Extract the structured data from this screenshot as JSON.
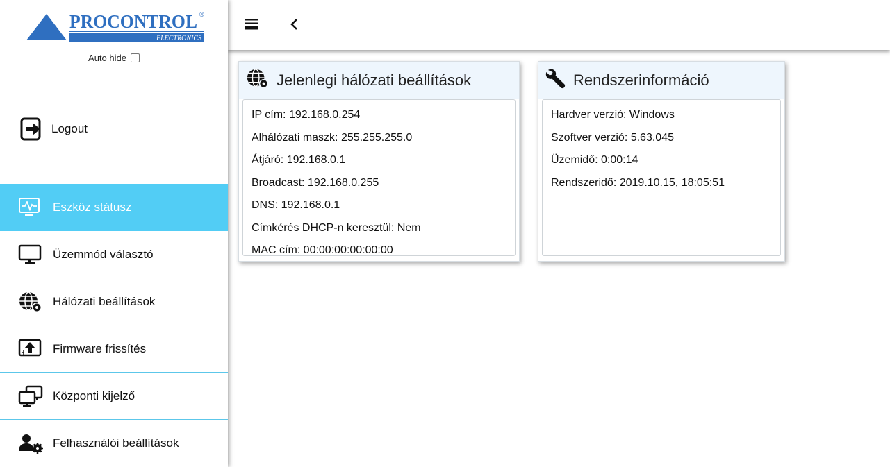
{
  "brand": {
    "name": "PROCONTROL",
    "sub": "ELECTRONICS",
    "registered": "®",
    "color": "#2f6fc0"
  },
  "sidebar": {
    "autohide_label": "Auto hide",
    "logout_label": "Logout",
    "items": [
      {
        "label": "Eszköz státusz",
        "icon": "monitor-pulse-icon",
        "active": true
      },
      {
        "label": "Üzemmód választó",
        "icon": "monitor-icon",
        "active": false
      },
      {
        "label": "Hálózati beállítások",
        "icon": "globe-gear-icon",
        "active": false
      },
      {
        "label": "Firmware frissítés",
        "icon": "upload-icon",
        "active": false
      },
      {
        "label": "Központi kijelző",
        "icon": "dual-monitor-icon",
        "active": false
      },
      {
        "label": "Felhasználói beállítások",
        "icon": "user-gear-icon",
        "active": false
      }
    ],
    "active_color": "#52cdf5"
  },
  "network_card": {
    "title": "Jelenlegi hálózati beállítások",
    "icon": "globe-gear-icon",
    "rows": [
      "IP cím: 192.168.0.254",
      "Alhálózati maszk: 255.255.255.0",
      "Átjáró: 192.168.0.1",
      "Broadcast: 192.168.0.255",
      "DNS: 192.168.0.1",
      "Címkérés DHCP-n keresztül: Nem",
      "MAC cím: 00:00:00:00:00:00"
    ]
  },
  "system_card": {
    "title": "Rendszerinformáció",
    "icon": "wrench-icon",
    "rows": [
      "Hardver verzió: Windows",
      "Szoftver verzió: 5.63.045",
      "Üzemidő: 0:00:14",
      "Rendszeridő: 2019.10.15, 18:05:51"
    ]
  }
}
